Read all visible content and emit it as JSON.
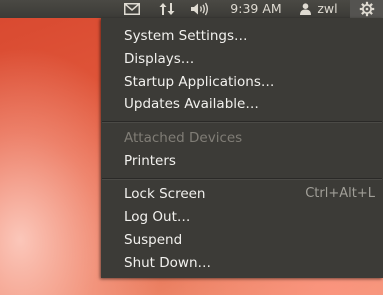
{
  "panel": {
    "indicators": [
      {
        "name": "messaging",
        "icon": "envelope-icon"
      },
      {
        "name": "network",
        "icon": "network-updown-icon"
      },
      {
        "name": "sound",
        "icon": "volume-icon"
      }
    ],
    "clock": "9:39 AM",
    "user": {
      "icon": "person-icon",
      "name": "zwl"
    },
    "session_icon": "gear-icon"
  },
  "menu": {
    "items": [
      {
        "label": "System Settings…",
        "enabled": true
      },
      {
        "label": "Displays…",
        "enabled": true
      },
      {
        "label": "Startup Applications…",
        "enabled": true
      },
      {
        "label": "Updates Available…",
        "enabled": true
      },
      {
        "label": "Attached Devices",
        "enabled": false
      },
      {
        "label": "Printers",
        "enabled": true
      },
      {
        "label": "Lock Screen",
        "accelerator": "Ctrl+Alt+L",
        "enabled": true
      },
      {
        "label": "Log Out…",
        "enabled": true
      },
      {
        "label": "Suspend",
        "enabled": true
      },
      {
        "label": "Shut Down…",
        "enabled": true
      }
    ]
  },
  "colors": {
    "panel_bg": "#3c3b37",
    "menu_bg": "#3c3b37",
    "menu_text": "#f2f1ee",
    "disabled_text": "#807d76",
    "desktop_red": "#e0533a"
  }
}
